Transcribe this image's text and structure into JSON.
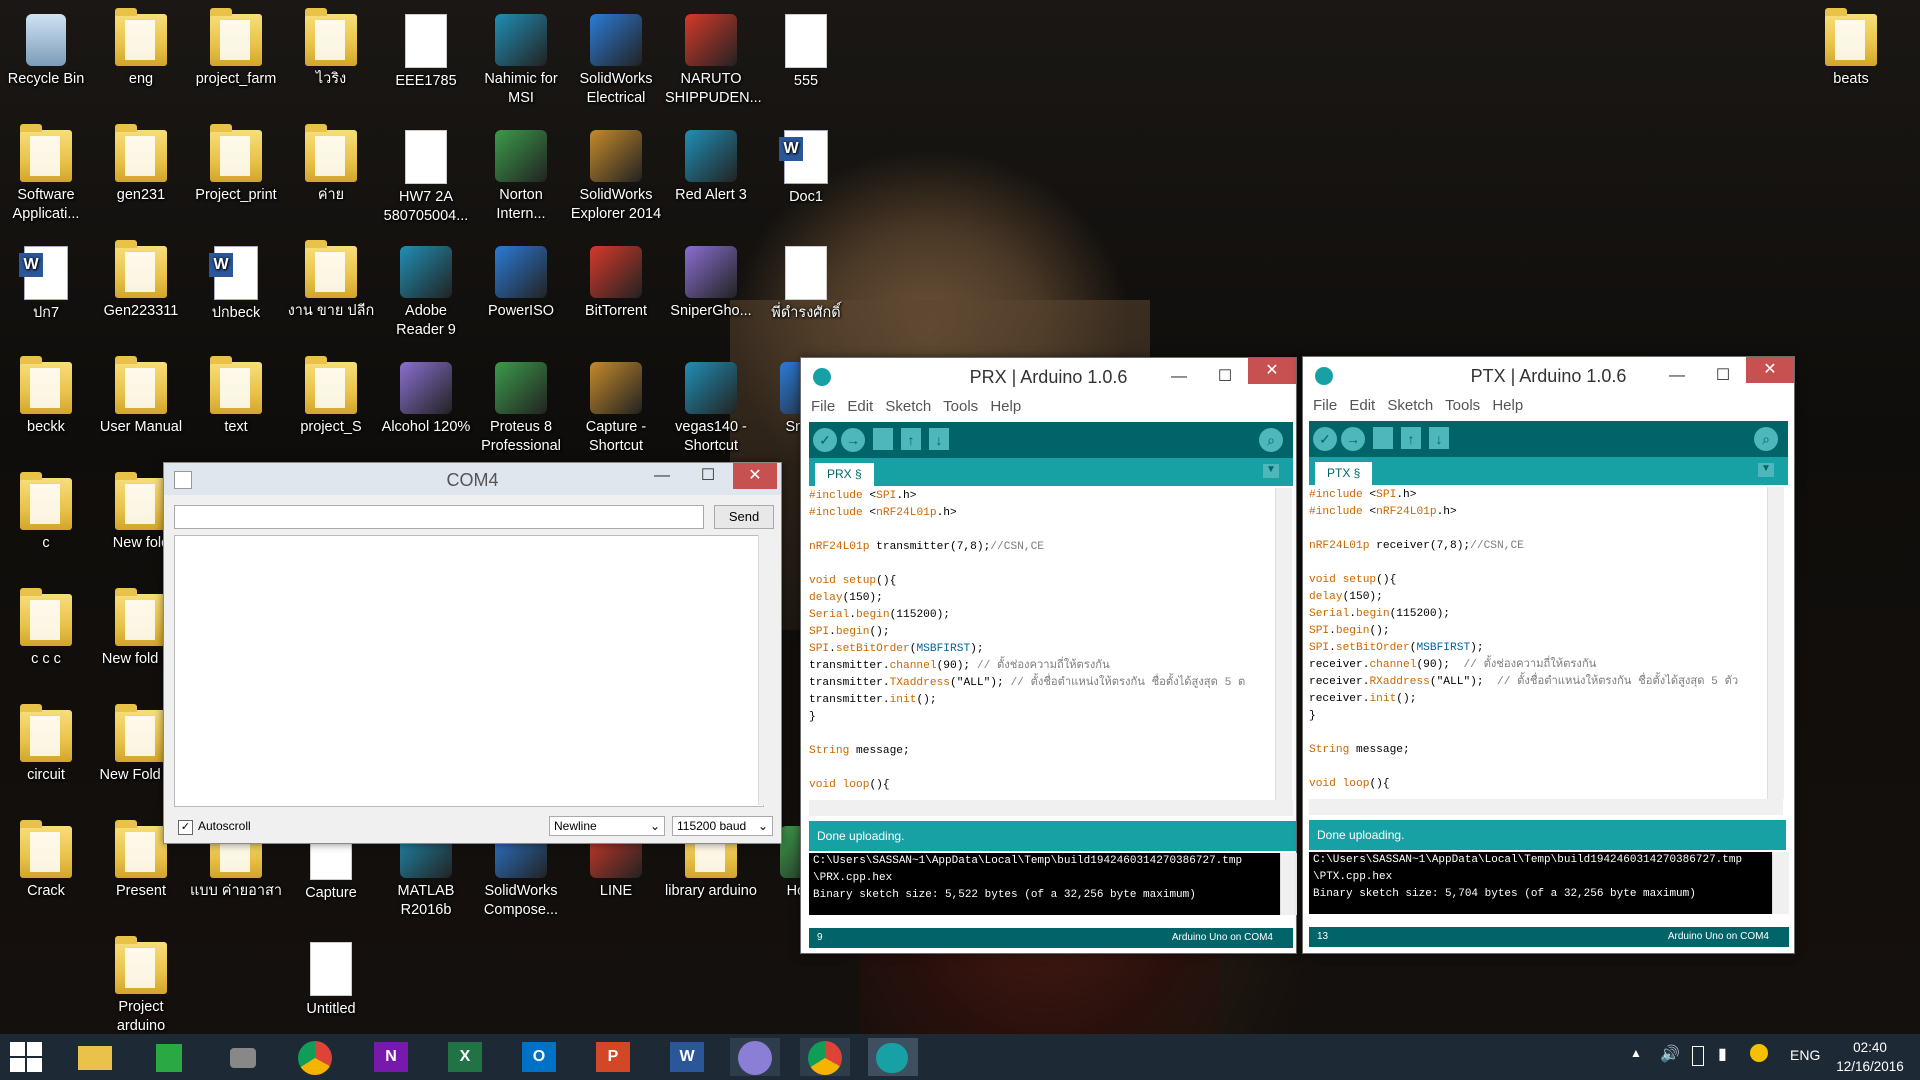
{
  "desktop": {
    "icons": [
      {
        "label": "Recycle Bin",
        "kind": "bin"
      },
      {
        "label": "eng",
        "kind": "folder"
      },
      {
        "label": "project_farm",
        "kind": "folder"
      },
      {
        "label": "ไวริง",
        "kind": "folder"
      },
      {
        "label": "EEE1785",
        "kind": "doc"
      },
      {
        "label": "Nahimic for MSI",
        "kind": "app"
      },
      {
        "label": "SolidWorks Electrical",
        "kind": "app"
      },
      {
        "label": "NARUTO SHIPPUDEN...",
        "kind": "app"
      },
      {
        "label": "555",
        "kind": "doc"
      },
      {
        "label": "beats",
        "kind": "folder"
      },
      {
        "label": "Software Applicati...",
        "kind": "folder"
      },
      {
        "label": "gen231",
        "kind": "folder"
      },
      {
        "label": "Project_print",
        "kind": "folder"
      },
      {
        "label": "ค่าย",
        "kind": "folder"
      },
      {
        "label": "HW7 2A 580705004...",
        "kind": "doc"
      },
      {
        "label": "Norton Intern...",
        "kind": "app"
      },
      {
        "label": "SolidWorks Explorer 2014",
        "kind": "app"
      },
      {
        "label": "Red Alert 3",
        "kind": "app"
      },
      {
        "label": "Doc1",
        "kind": "word"
      },
      {
        "label": "ปก7",
        "kind": "word"
      },
      {
        "label": "Gen223311",
        "kind": "folder"
      },
      {
        "label": "ปกbeck",
        "kind": "word"
      },
      {
        "label": "งาน ขาย ปลีก",
        "kind": "folder"
      },
      {
        "label": "Adobe Reader 9",
        "kind": "app"
      },
      {
        "label": "PowerISO",
        "kind": "app"
      },
      {
        "label": "BitTorrent",
        "kind": "app"
      },
      {
        "label": "SniperGho...",
        "kind": "app"
      },
      {
        "label": "พี่ดำรงศักดิ์",
        "kind": "doc"
      },
      {
        "label": "beckk",
        "kind": "folder"
      },
      {
        "label": "User Manual",
        "kind": "folder"
      },
      {
        "label": "text",
        "kind": "folder"
      },
      {
        "label": "project_S",
        "kind": "folder"
      },
      {
        "label": "Alcohol 120%",
        "kind": "app"
      },
      {
        "label": "Proteus 8 Professional",
        "kind": "app"
      },
      {
        "label": "Capture - Shortcut",
        "kind": "app"
      },
      {
        "label": "vegas140 - Shortcut",
        "kind": "app"
      },
      {
        "label": "Snook",
        "kind": "app"
      },
      {
        "label": "c",
        "kind": "folder"
      },
      {
        "label": "New fold",
        "kind": "folder"
      },
      {
        "label": "c c c",
        "kind": "folder"
      },
      {
        "label": "New fold (2)",
        "kind": "folder"
      },
      {
        "label": "circuit",
        "kind": "folder"
      },
      {
        "label": "New Fold (3)",
        "kind": "folder"
      },
      {
        "label": "Crack",
        "kind": "folder"
      },
      {
        "label": "Present",
        "kind": "folder"
      },
      {
        "label": "แบบ ค่ายอาสา",
        "kind": "folder"
      },
      {
        "label": "Capture",
        "kind": "doc"
      },
      {
        "label": "MATLAB R2016b",
        "kind": "app"
      },
      {
        "label": "SolidWorks Compose...",
        "kind": "app"
      },
      {
        "label": "LINE",
        "kind": "app"
      },
      {
        "label": "library arduino",
        "kind": "folder"
      },
      {
        "label": "Home",
        "kind": "app"
      },
      {
        "label": "Project arduino",
        "kind": "folder"
      },
      {
        "label": "Untitled",
        "kind": "doc"
      }
    ]
  },
  "serial_monitor": {
    "title": "COM4",
    "send_label": "Send",
    "input_value": "",
    "autoscroll_label": "Autoscroll",
    "autoscroll_checked": true,
    "line_ending": "Newline",
    "baud": "115200 baud"
  },
  "prx": {
    "title": "PRX | Arduino 1.0.6",
    "menu": [
      "File",
      "Edit",
      "Sketch",
      "Tools",
      "Help"
    ],
    "tab": "PRX §",
    "code": [
      "#include <SPI.h>",
      "#include <nRF24L01p.h>",
      "",
      "nRF24L01p transmitter(7,8);//CSN,CE",
      "",
      "void setup(){",
      "delay(150);",
      "Serial.begin(115200);",
      "SPI.begin();",
      "SPI.setBitOrder(MSBFIRST);",
      "transmitter.channel(90); // ตั้งช่องความถี่ให้ตรงกัน",
      "transmitter.TXaddress(\"ALL\"); // ตั้งชื่อตำแหน่งให้ตรงกัน ชื่อตั้งได้สูงสุด 5 ต",
      "transmitter.init();",
      "}",
      "",
      "String message;",
      "",
      "void loop(){"
    ],
    "status": "Done uploading.",
    "console": [
      "C:\\Users\\SASSAN~1\\AppData\\Local\\Temp\\build1942460314270386727.tmp",
      "\\PRX.cpp.hex",
      "Binary sketch size: 5,522 bytes (of a 32,256 byte maximum)"
    ],
    "line_no": "9",
    "board": "Arduino Uno on COM4"
  },
  "ptx": {
    "title": "PTX | Arduino 1.0.6",
    "menu": [
      "File",
      "Edit",
      "Sketch",
      "Tools",
      "Help"
    ],
    "tab": "PTX §",
    "code": [
      "#include <SPI.h>",
      "#include <nRF24L01p.h>",
      "",
      "nRF24L01p receiver(7,8);//CSN,CE",
      "",
      "void setup(){",
      "delay(150);",
      "Serial.begin(115200);",
      "SPI.begin();",
      "SPI.setBitOrder(MSBFIRST);",
      "receiver.channel(90);  // ตั้งช่องความถี่ให้ตรงกัน",
      "receiver.RXaddress(\"ALL\");  // ตั้งชื่อตำแหน่งให้ตรงกัน ชื่อตั้งได้สูงสุด 5 ตัว",
      "receiver.init();",
      "}",
      "",
      "String message;",
      "",
      "void loop(){"
    ],
    "status": "Done uploading.",
    "console": [
      "C:\\Users\\SASSAN~1\\AppData\\Local\\Temp\\build1942460314270386727.tmp",
      "\\PTX.cpp.hex",
      "Binary sketch size: 5,704 bytes (of a 32,256 byte maximum)"
    ],
    "line_no": "13",
    "board": "Arduino Uno on COM4"
  },
  "taskbar": {
    "apps": [
      "start",
      "file-explorer",
      "store",
      "task-view",
      "chrome",
      "onenote",
      "excel",
      "outlook",
      "powerpoint",
      "word",
      "bittorrent",
      "chrome",
      "arduino"
    ],
    "lang": "ENG",
    "time": "02:40",
    "date": "12/16/2016"
  },
  "colors": {
    "arduino_dark": "#006468",
    "arduino_teal": "#17a1a5",
    "close": "#c75050",
    "taskbar": "#1d2a36"
  }
}
